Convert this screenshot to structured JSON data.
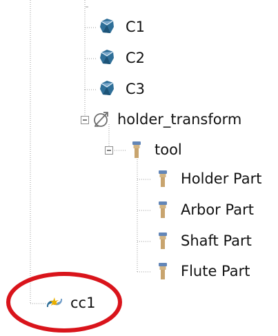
{
  "tree": {
    "nodes": [
      {
        "label": "C1",
        "icon": "component-icon"
      },
      {
        "label": "C2",
        "icon": "component-icon"
      },
      {
        "label": "C3",
        "icon": "component-icon"
      },
      {
        "label": "holder_transform",
        "icon": "transform-icon",
        "expanded": true
      },
      {
        "label": "tool",
        "icon": "tool-icon",
        "expanded": true
      },
      {
        "label": "Holder Part",
        "icon": "tool-part-icon"
      },
      {
        "label": "Arbor Part",
        "icon": "tool-part-icon"
      },
      {
        "label": "Shaft Part",
        "icon": "tool-part-icon"
      },
      {
        "label": "Flute Part",
        "icon": "tool-part-icon"
      },
      {
        "label": "cc1",
        "icon": "contact-condition-icon",
        "highlighted": true
      }
    ]
  },
  "colors": {
    "connector": "#9a9a9a",
    "highlight_ellipse": "#d9141b",
    "component_blue": "#2f6f98",
    "tool_tan": "#d2b483",
    "tool_blue": "#6286b8"
  }
}
